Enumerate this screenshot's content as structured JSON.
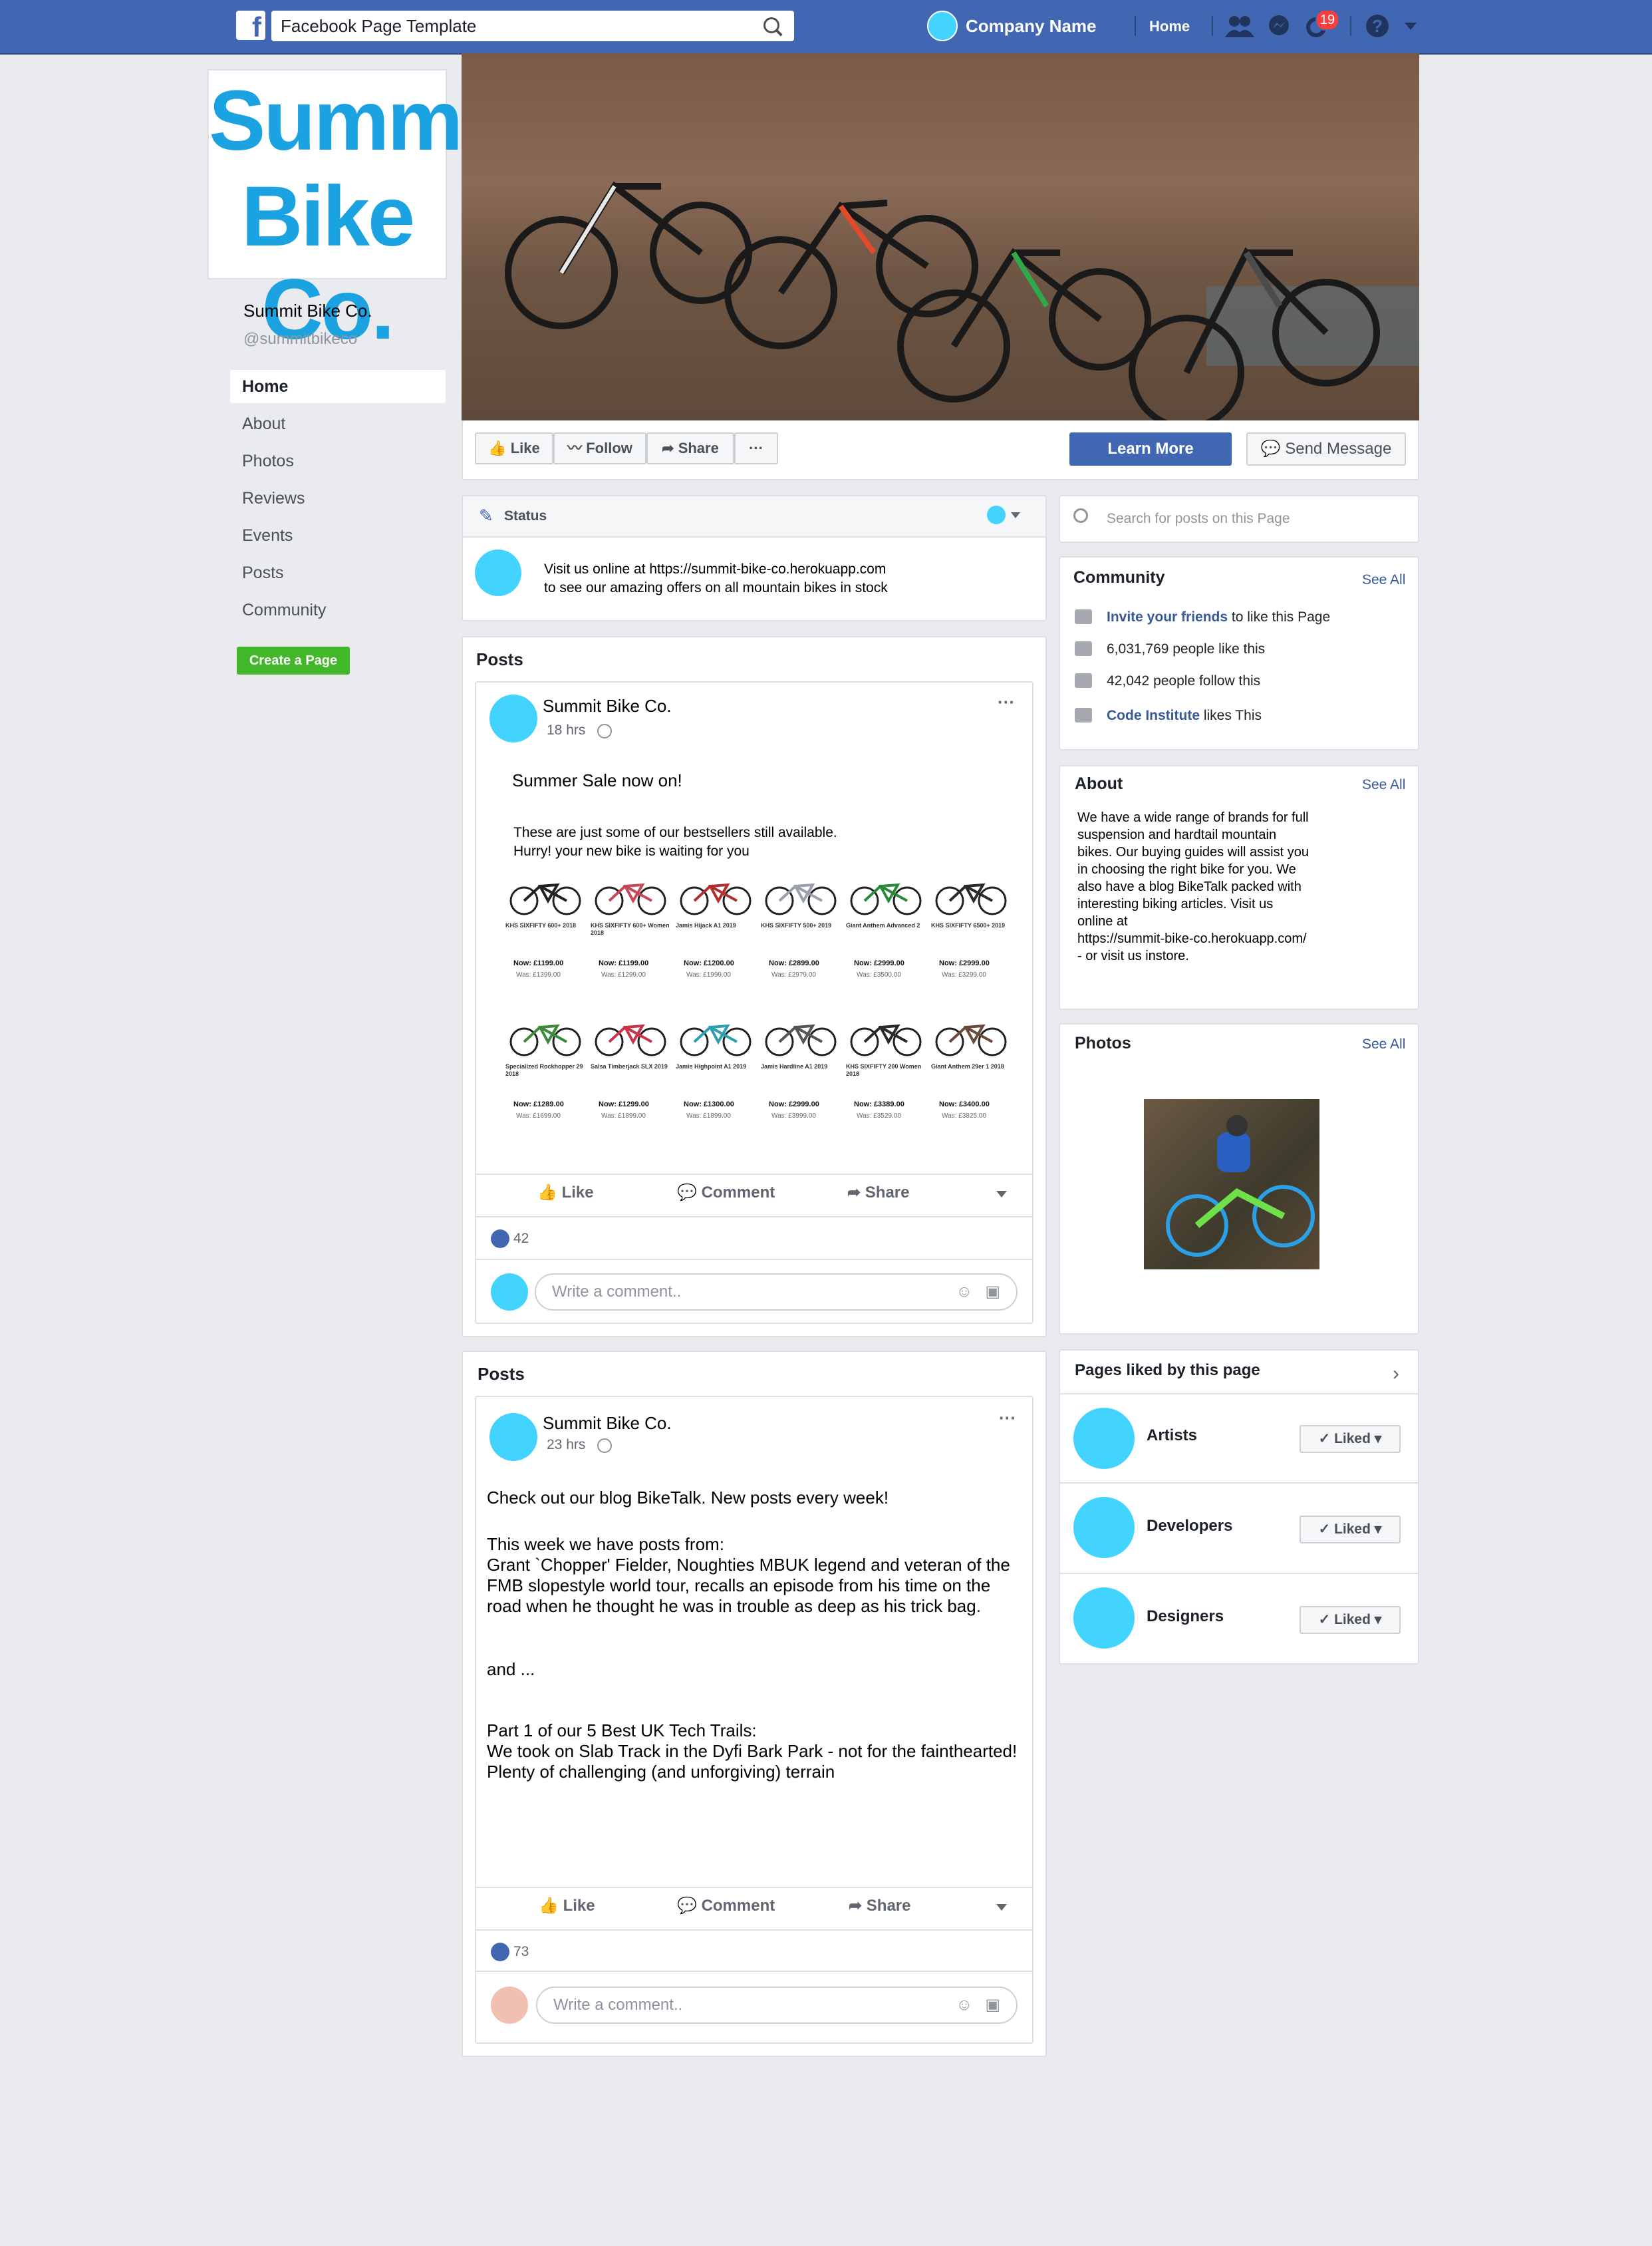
{
  "topbar": {
    "search_value": "Facebook Page Template",
    "company_name": "Company Name",
    "home_label": "Home",
    "notifications_count": "19"
  },
  "page": {
    "logo_line1": "Summit",
    "logo_line2": "Bike Co.",
    "name": "Summit Bike Co.",
    "handle": "@summitbikeco",
    "colors": {
      "brand_blue": "#4267b2",
      "logo_cyan": "#1aa3e0",
      "avatar_cyan": "#42d4ff",
      "create_green": "#42b72a"
    }
  },
  "sidebar": {
    "items": [
      {
        "label": "Home"
      },
      {
        "label": "About"
      },
      {
        "label": "Photos"
      },
      {
        "label": "Reviews"
      },
      {
        "label": "Events"
      },
      {
        "label": "Posts"
      },
      {
        "label": "Community"
      }
    ],
    "create_page": "Create a Page"
  },
  "actions": {
    "like": "Like",
    "follow": "Follow",
    "share": "Share",
    "more": "···",
    "learn_more": "Learn More",
    "send_message": "Send Message"
  },
  "status": {
    "label": "Status",
    "line1": "Visit us online at https://summit-bike-co.herokuapp.com",
    "line2": "to see our amazing offers on all mountain bikes in stock"
  },
  "posts": [
    {
      "section_title": "Posts",
      "author": "Summit Bike Co.",
      "time": "18 hrs",
      "headline": "Summer Sale now on!",
      "line1": "These are just some of our bestsellers still available.",
      "line2": "Hurry! your new bike is waiting for you",
      "products": [
        {
          "name": "KHS SIXFIFTY 600+ 2018",
          "now": "Now: £1199.00",
          "was": "Was: £1399.00"
        },
        {
          "name": "KHS SIXFIFTY 600+ Women 2018",
          "now": "Now: £1199.00",
          "was": "Was: £1299.00"
        },
        {
          "name": "Jamis Hijack A1 2019",
          "now": "Now: £1200.00",
          "was": "Was: £1999.00"
        },
        {
          "name": "KHS SIXFIFTY 500+ 2019",
          "now": "Now: £2899.00",
          "was": "Was: £2979.00"
        },
        {
          "name": "Giant Anthem Advanced 2",
          "now": "Now: £2999.00",
          "was": "Was: £3500.00"
        },
        {
          "name": "KHS SIXFIFTY 6500+ 2019",
          "now": "Now: £2999.00",
          "was": "Was: £3299.00"
        },
        {
          "name": "Specialized Rockhopper 29 2018",
          "now": "Now: £1289.00",
          "was": "Was: £1699.00"
        },
        {
          "name": "Salsa Timberjack SLX 2019",
          "now": "Now: £1299.00",
          "was": "Was: £1899.00"
        },
        {
          "name": "Jamis Highpoint A1 2019",
          "now": "Now: £1300.00",
          "was": "Was: £1899.00"
        },
        {
          "name": "Jamis Hardline A1 2019",
          "now": "Now: £2999.00",
          "was": "Was: £3999.00"
        },
        {
          "name": "KHS SIXFIFTY 200 Women 2018",
          "now": "Now: £3389.00",
          "was": "Was: £3529.00"
        },
        {
          "name": "Giant Anthem 29er 1 2018",
          "now": "Now: £3400.00",
          "was": "Was: £3825.00"
        }
      ],
      "like": "Like",
      "comment": "Comment",
      "share": "Share",
      "likes_count": "42",
      "comment_placeholder": "Write a comment.."
    },
    {
      "section_title": "Posts",
      "author": "Summit Bike Co.",
      "time": "23 hrs",
      "p1": "Check out our blog BikeTalk. New posts every week!",
      "p2a": "This week we have posts from:",
      "p2b": "Grant `Chopper' Fielder, Noughties MBUK legend and veteran of the",
      "p2c": "FMB slopestyle world tour, recalls an episode from his time on the",
      "p2d": "road when he thought he was in trouble as deep as his trick bag.",
      "p3": "and ...",
      "p4a": "Part 1 of our 5 Best UK Tech Trails:",
      "p4b": "We took on Slab Track in the Dyfi Bark Park - not for the fainthearted!",
      "p4c": "Plenty of challenging (and unforgiving) terrain",
      "like": "Like",
      "comment": "Comment",
      "share": "Share",
      "likes_count": "73",
      "comment_placeholder": "Write a comment.."
    }
  ],
  "right": {
    "search_placeholder": "Search for posts on this Page",
    "community": {
      "title": "Community",
      "see_all": "See All",
      "invite_link": "Invite your friends",
      "invite_rest": "to like this Page",
      "likes": "6,031,769 people like this",
      "follows": "42,042 people follow this",
      "ci_link": "Code Institute",
      "ci_rest": "likes This"
    },
    "about": {
      "title": "About",
      "see_all": "See All",
      "lines": [
        "We have a wide range of brands for full",
        "suspension and hardtail mountain",
        "bikes.  Our buying guides will assist you",
        "in choosing the right bike for you.  We",
        "also have a blog BikeTalk packed with",
        "interesting biking articles.  Visit us",
        "online at",
        "https://summit-bike-co.herokuapp.com/",
        "- or visit us instore."
      ]
    },
    "photos": {
      "title": "Photos",
      "see_all": "See All"
    },
    "pages_liked": {
      "title": "Pages liked by this page",
      "items": [
        {
          "name": "Artists",
          "button": "Liked"
        },
        {
          "name": "Developers",
          "button": "Liked"
        },
        {
          "name": "Designers",
          "button": "Liked"
        }
      ]
    }
  }
}
